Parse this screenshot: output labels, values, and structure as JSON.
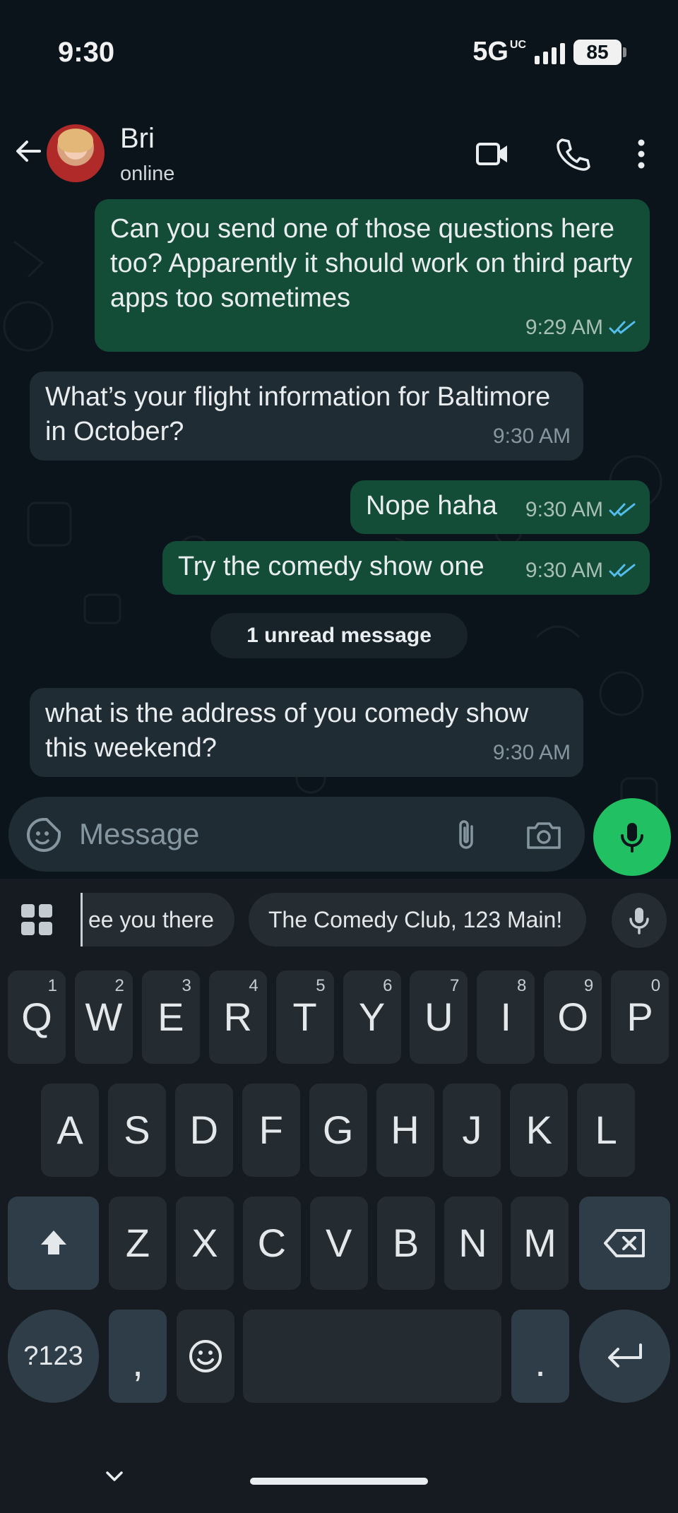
{
  "status_bar": {
    "time": "9:30",
    "network": "5G",
    "network_sub": "UC",
    "battery": "85"
  },
  "header": {
    "contact_name": "Bri",
    "contact_status": "online"
  },
  "messages": [
    {
      "direction": "out",
      "text": "Can you send one of those questions here too? Apparently it should work on third party apps too sometimes",
      "time": "9:29 AM",
      "read": true
    },
    {
      "direction": "in",
      "text": "What’s your flight information for Baltimore in October?",
      "time": "9:30 AM"
    },
    {
      "direction": "out",
      "text": "Nope haha",
      "time": "9:30 AM",
      "read": true
    },
    {
      "direction": "out",
      "text": "Try the comedy show one",
      "time": "9:30 AM",
      "read": true
    },
    {
      "direction": "in",
      "text": "what is the address of you comedy show this weekend?",
      "time": "9:30 AM"
    }
  ],
  "unread_divider": "1 unread message",
  "composer": {
    "placeholder": "Message",
    "value": ""
  },
  "keyboard": {
    "suggestions": [
      "ee you there",
      "The Comedy Club, 123 Main!"
    ],
    "row1": [
      {
        "k": "Q",
        "n": "1"
      },
      {
        "k": "W",
        "n": "2"
      },
      {
        "k": "E",
        "n": "3"
      },
      {
        "k": "R",
        "n": "4"
      },
      {
        "k": "T",
        "n": "5"
      },
      {
        "k": "Y",
        "n": "6"
      },
      {
        "k": "U",
        "n": "7"
      },
      {
        "k": "I",
        "n": "8"
      },
      {
        "k": "O",
        "n": "9"
      },
      {
        "k": "P",
        "n": "0"
      }
    ],
    "row2": [
      "A",
      "S",
      "D",
      "F",
      "G",
      "H",
      "J",
      "K",
      "L"
    ],
    "row3": [
      "Z",
      "X",
      "C",
      "V",
      "B",
      "N",
      "M"
    ],
    "symbols_key": "?123",
    "comma_key": ",",
    "period_key": "."
  },
  "colors": {
    "outgoing": "#144d37",
    "incoming": "#202c33",
    "accent": "#21c063",
    "read_ticks": "#53bdeb"
  }
}
